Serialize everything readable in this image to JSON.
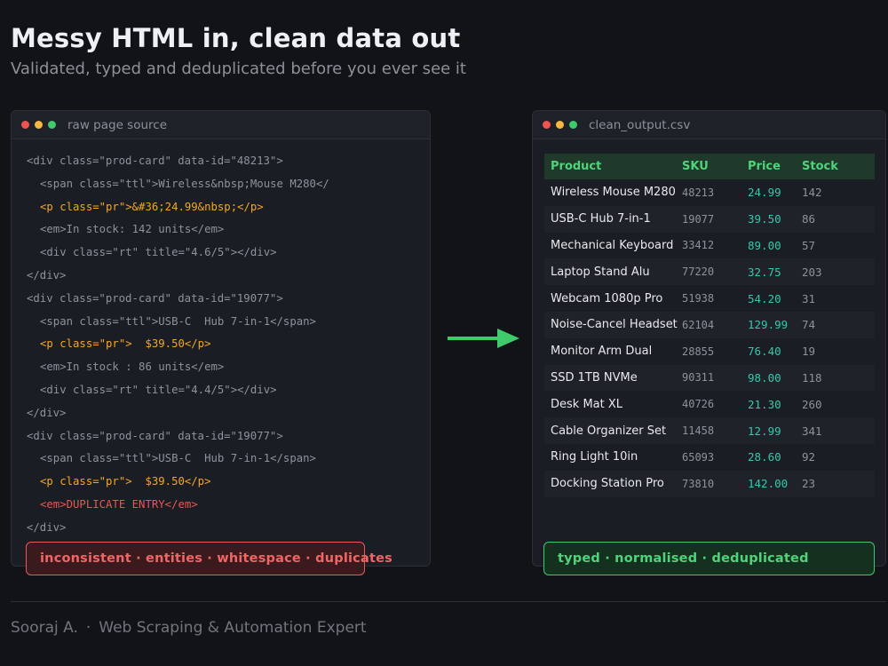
{
  "header": {
    "title": "Messy HTML in, clean data out",
    "subtitle": "Validated, typed and deduplicated before you ever see it"
  },
  "left_panel": {
    "name": "raw page source",
    "lines": [
      "<div class=\"prod-card\" data-id=\"48213\">",
      "<span class=\"ttl\">Wireless&nbsp;Mouse M280</",
      "<p class=\"pr\">&#36;24.99&nbsp;</p>",
      "<em>In stock: 142 units</em>",
      "<div class=\"rt\" title=\"4.6/5\"></div>",
      "</div>",
      "<div class=\"prod-card\" data-id=\"19077\">",
      "<span class=\"ttl\">USB-C  Hub 7-in-1</span>",
      "<p class=\"pr\">  $39.50</p>",
      "<em>In stock : 86 units</em>",
      "<div class=\"rt\" title=\"4.4/5\"></div>",
      "</div>",
      "<div class=\"prod-card\" data-id=\"19077\">",
      "<span class=\"ttl\">USB-C  Hub 7-in-1</span>",
      "<p class=\"pr\">  $39.50</p>",
      "<em>DUPLICATE ENTRY</em>",
      "</div>"
    ],
    "badge": "inconsistent · entities · whitespace · duplicates"
  },
  "right_panel": {
    "name": "clean_output.csv",
    "columns": [
      "Product",
      "SKU",
      "Price",
      "Stock"
    ],
    "rows": [
      [
        "Wireless Mouse M280",
        "48213",
        "24.99",
        "142"
      ],
      [
        "USB-C Hub 7-in-1",
        "19077",
        "39.50",
        "86"
      ],
      [
        "Mechanical Keyboard",
        "33412",
        "89.00",
        "57"
      ],
      [
        "Laptop Stand Alu",
        "77220",
        "32.75",
        "203"
      ],
      [
        "Webcam 1080p Pro",
        "51938",
        "54.20",
        "31"
      ],
      [
        "Noise-Cancel Headset",
        "62104",
        "129.99",
        "74"
      ],
      [
        "Monitor Arm Dual",
        "28855",
        "76.40",
        "19"
      ],
      [
        "SSD 1TB NVMe",
        "90311",
        "98.00",
        "118"
      ],
      [
        "Desk Mat XL",
        "40726",
        "21.30",
        "260"
      ],
      [
        "Cable Organizer Set",
        "11458",
        "12.99",
        "341"
      ],
      [
        "Ring Light 10in",
        "65093",
        "28.60",
        "92"
      ],
      [
        "Docking Station Pro",
        "73810",
        "142.00",
        "23"
      ]
    ],
    "badge": "typed · normalised · deduplicated"
  },
  "footer": {
    "author": "Sooraj A.",
    "separator": "·",
    "role": "Web Scraping & Automation Expert"
  },
  "colors": {
    "background": "#121316",
    "accent_green": "#3fca6b",
    "error_red": "#ef5350",
    "price_orange": "#f5a623",
    "price_teal": "#33c9ac"
  }
}
